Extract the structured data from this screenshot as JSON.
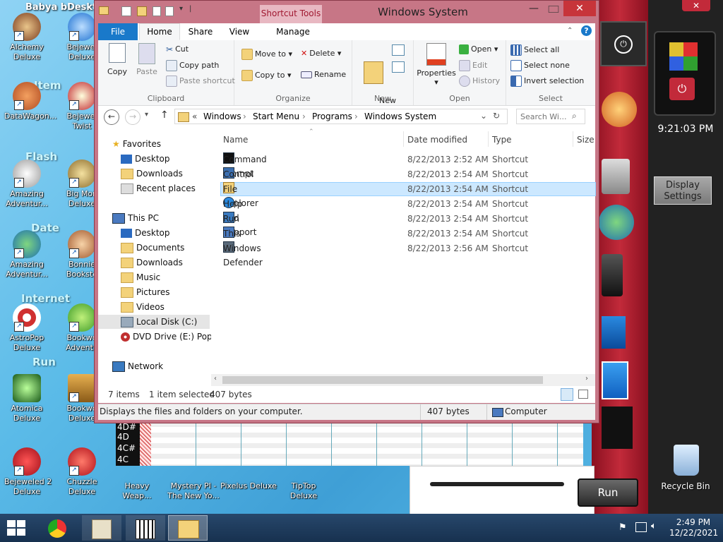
{
  "desktop": {
    "icons": [
      {
        "label": "Alchemy\nDeluxe"
      },
      {
        "label": "Bejewel\nDeluxe"
      },
      {
        "label": "DataWagon..."
      },
      {
        "label": "Bejewel\nTwist"
      },
      {
        "label": "Amazing\nAdventur..."
      },
      {
        "label": "Big Mon\nDeluxe"
      },
      {
        "label": "Amazing\nAdventur..."
      },
      {
        "label": "Bonnie\nBooksto"
      },
      {
        "label": "AstroPop\nDeluxe"
      },
      {
        "label": "Bookwo\nAdventu"
      },
      {
        "label": "Atomica\nDeluxe"
      },
      {
        "label": "Bookwo\nDeluxe"
      },
      {
        "label": "Bejeweled 2\nDeluxe"
      },
      {
        "label": "Chuzzle\nDeluxe"
      },
      {
        "label": "Heavy\nWeap..."
      },
      {
        "label": "Mystery PI -\nThe New Yo..."
      },
      {
        "label": "Pixelus Deluxe"
      },
      {
        "label": "TipTop\nDeluxe"
      },
      {
        "label": "Recycle Bin"
      }
    ],
    "banners": [
      "Item",
      "Flash",
      "Date",
      "Internet",
      "Run"
    ],
    "top_left_label": "Babya bDeskt"
  },
  "side_panel": {
    "clock": "9:21:03 PM",
    "display_settings": "Display\nSettings",
    "run_label": "Run"
  },
  "grid_notes": [
    "4D#",
    "4D",
    "4C#",
    "4C"
  ],
  "explorer": {
    "title": "Windows System",
    "context_tab": "Shortcut Tools",
    "tabs": [
      "File",
      "Home",
      "Share",
      "View",
      "Manage"
    ],
    "ribbon": {
      "clipboard": {
        "label": "Clipboard",
        "copy": "Copy",
        "paste": "Paste",
        "cut": "Cut",
        "copy_path": "Copy path",
        "paste_shortcut": "Paste shortcut"
      },
      "organize": {
        "label": "Organize",
        "move_to": "Move to",
        "copy_to": "Copy to",
        "delete": "Delete",
        "rename": "Rename"
      },
      "new": {
        "label": "New",
        "new_folder": "New\nfolder"
      },
      "open": {
        "label": "Open",
        "properties": "Properties",
        "open": "Open",
        "edit": "Edit",
        "history": "History"
      },
      "select": {
        "label": "Select",
        "select_all": "Select all",
        "select_none": "Select none",
        "invert": "Invert selection"
      }
    },
    "address": {
      "prefix": "«",
      "crumbs": [
        "Windows",
        "Start Menu",
        "Programs",
        "Windows System"
      ]
    },
    "search_placeholder": "Search Wi...",
    "columns": {
      "name": "Name",
      "date": "Date modified",
      "type": "Type",
      "size": "Size"
    },
    "nav": {
      "favorites": "Favorites",
      "fav_items": [
        "Desktop",
        "Downloads",
        "Recent places"
      ],
      "this_pc": "This PC",
      "pc_items": [
        "Desktop",
        "Documents",
        "Downloads",
        "Music",
        "Pictures",
        "Videos",
        "Local Disk (C:)",
        "DVD Drive (E:) Popca"
      ],
      "network": "Network"
    },
    "files": [
      {
        "name": "Command Prompt",
        "date": "8/22/2013 2:52 AM",
        "type": "Shortcut"
      },
      {
        "name": "Control Panel",
        "date": "8/22/2013 2:54 AM",
        "type": "Shortcut"
      },
      {
        "name": "File Explorer",
        "date": "8/22/2013 2:54 AM",
        "type": "Shortcut"
      },
      {
        "name": "Help and Support",
        "date": "8/22/2013 2:54 AM",
        "type": "Shortcut"
      },
      {
        "name": "Run",
        "date": "8/22/2013 2:54 AM",
        "type": "Shortcut"
      },
      {
        "name": "This PC",
        "date": "8/22/2013 2:54 AM",
        "type": "Shortcut"
      },
      {
        "name": "Windows Defender",
        "date": "8/22/2013 2:56 AM",
        "type": "Shortcut"
      }
    ],
    "status": {
      "items": "7 items",
      "selected": "1 item selected",
      "size": "407 bytes"
    },
    "bottom": {
      "description": "Displays the files and folders on your computer.",
      "size": "407 bytes",
      "location": "Computer"
    }
  },
  "taskbar": {
    "time": "2:49 PM",
    "date": "12/22/2021"
  }
}
